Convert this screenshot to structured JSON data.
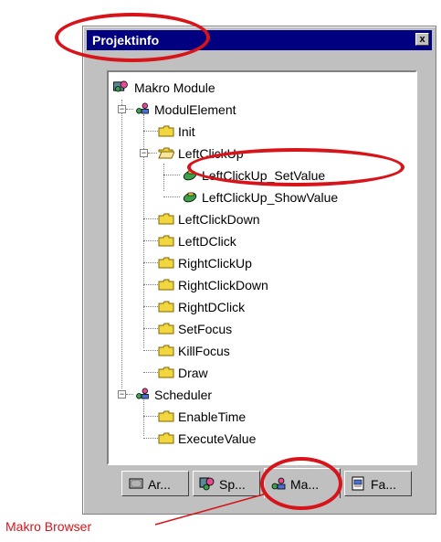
{
  "window": {
    "title": "Projektinfo",
    "close_label": "x"
  },
  "tree": {
    "root": "Makro Module",
    "groups": [
      {
        "label": "ModulElement",
        "children": [
          {
            "label": "Init"
          },
          {
            "label": "LeftClickUp",
            "children": [
              "LeftClickUp_SetValue",
              "LeftClickUp_ShowValue"
            ]
          },
          {
            "label": "LeftClickDown"
          },
          {
            "label": "LeftDClick"
          },
          {
            "label": "RightClickUp"
          },
          {
            "label": "RightClickDown"
          },
          {
            "label": "RightDClick"
          },
          {
            "label": "SetFocus"
          },
          {
            "label": "KillFocus"
          },
          {
            "label": "Draw"
          }
        ]
      },
      {
        "label": "Scheduler",
        "children": [
          {
            "label": "EnableTime"
          },
          {
            "label": "ExecuteValue"
          }
        ]
      }
    ]
  },
  "tabs": [
    {
      "label": "Ar..."
    },
    {
      "label": "Sp..."
    },
    {
      "label": "Ma...",
      "active": true
    },
    {
      "label": "Fa..."
    }
  ],
  "annotation": {
    "caption": "Makro Browser",
    "color": "#d7141a"
  },
  "colors": {
    "titlebar": "#000080",
    "folder": "#f2d640",
    "face": "#c0c0c0"
  }
}
